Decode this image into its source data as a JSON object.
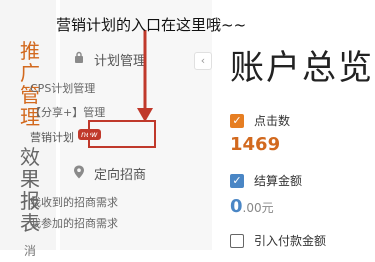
{
  "annotation": {
    "text": "营销计划的入口在这里哦~~"
  },
  "leftnav": {
    "items": [
      {
        "label": "推广管理"
      },
      {
        "label": "效果报表"
      },
      {
        "label": "消"
      }
    ]
  },
  "submenu": {
    "collapse_icon": "‹",
    "sections": [
      {
        "title": "计划管理",
        "icon": "lock-icon",
        "items": [
          {
            "label": "CPS计划管理"
          },
          {
            "label": "【分享+】管理"
          },
          {
            "label": "营销计划",
            "badge": "new"
          }
        ]
      },
      {
        "title": "定向招商",
        "icon": "location-pin-icon",
        "items": [
          {
            "label": "我收到的招商需求"
          },
          {
            "label": "我参加的招商需求"
          }
        ]
      }
    ]
  },
  "overview": {
    "title": "账户总览",
    "metrics": [
      {
        "label": "点击数",
        "value": "1469",
        "checked": true,
        "color": "#e67e22"
      },
      {
        "label": "结算金额",
        "value_int": "0",
        "value_dec": ".00",
        "unit": "元",
        "checked": true,
        "color": "#4a86c5"
      },
      {
        "label": "引入付款金额",
        "checked": false
      }
    ]
  },
  "colors": {
    "accent_orange": "#d2691e",
    "highlight_red": "#c0392b",
    "accent_blue": "#4a86c5"
  }
}
